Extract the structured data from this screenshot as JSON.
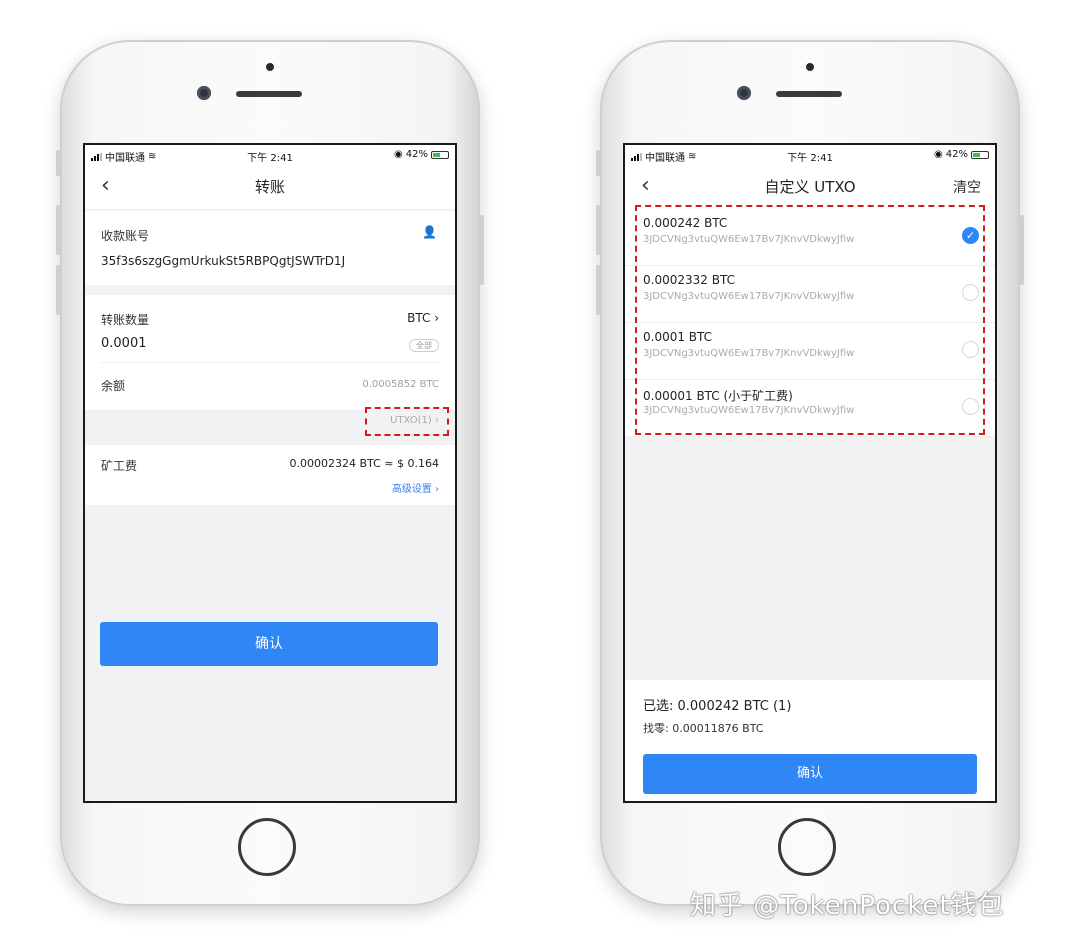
{
  "status": {
    "carrier": "中国联通",
    "time": "下午 2:41",
    "battery": "42%"
  },
  "left": {
    "title": "转账",
    "recipient_label": "收款账号",
    "recipient_address": "35f3s6szgGgmUrkukSt5RBPQgtJSWTrD1J",
    "amount_label": "转账数量",
    "currency": "BTC",
    "amount_value": "0.0001",
    "all_button": "全部",
    "balance_label": "余额",
    "balance_value": "0.0005852 BTC",
    "utxo_link": "UTXO(1)",
    "fee_label": "矿工费",
    "fee_value": "0.00002324 BTC ≈ $ 0.164",
    "advanced_link": "高级设置",
    "confirm": "确认"
  },
  "right": {
    "title": "自定义 UTXO",
    "clear": "清空",
    "utxos": [
      {
        "amount": "0.000242 BTC",
        "address": "3JDCVNg3vtuQW6Ew17Bv7JKnvVDkwyJfiw",
        "selected": true
      },
      {
        "amount": "0.0002332 BTC",
        "address": "3JDCVNg3vtuQW6Ew17Bv7JKnvVDkwyJfiw",
        "selected": false
      },
      {
        "amount": "0.0001 BTC",
        "address": "3JDCVNg3vtuQW6Ew17Bv7JKnvVDkwyJfiw",
        "selected": false
      },
      {
        "amount": "0.00001 BTC (小于矿工费)",
        "address": "3JDCVNg3vtuQW6Ew17Bv7JKnvVDkwyJfiw",
        "selected": false
      }
    ],
    "selected_summary": "已选: 0.000242 BTC (1)",
    "change_summary": "找零: 0.00011876 BTC",
    "confirm": "确认"
  },
  "watermark": "知乎 @TokenPocket钱包",
  "colors": {
    "accent": "#2f86f6",
    "highlight_dash": "#d61a1a"
  }
}
